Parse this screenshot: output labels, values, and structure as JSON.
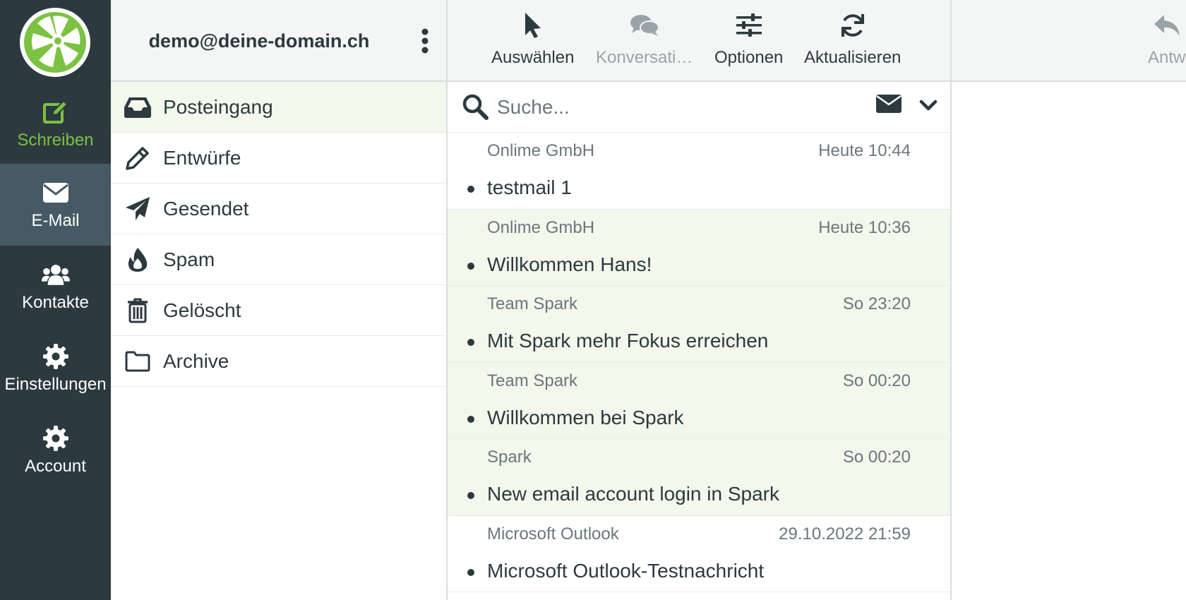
{
  "nav": {
    "items": [
      {
        "label": "Schreiben",
        "icon": "compose-icon"
      },
      {
        "label": "E-Mail",
        "icon": "envelope-icon"
      },
      {
        "label": "Kontakte",
        "icon": "users-icon"
      },
      {
        "label": "Einstellungen",
        "icon": "gear-icon"
      },
      {
        "label": "Account",
        "icon": "gear-icon"
      }
    ],
    "active": "E-Mail"
  },
  "account": {
    "email": "demo@deine-domain.ch"
  },
  "folders": [
    {
      "label": "Posteingang",
      "icon": "inbox-icon",
      "active": true
    },
    {
      "label": "Entwürfe",
      "icon": "pencil-icon"
    },
    {
      "label": "Gesendet",
      "icon": "paper-plane-icon"
    },
    {
      "label": "Spam",
      "icon": "fire-icon"
    },
    {
      "label": "Gelöscht",
      "icon": "trash-icon"
    },
    {
      "label": "Archive",
      "icon": "folder-icon"
    }
  ],
  "toolbar": {
    "select": "Auswählen",
    "conversations": "Konversati…",
    "options": "Optionen",
    "refresh": "Aktualisieren",
    "reply": "Antw"
  },
  "search": {
    "placeholder": "Suche..."
  },
  "messages": [
    {
      "sender": "Onlime GmbH",
      "date": "Heute 10:44",
      "subject": "testmail 1",
      "unread": false
    },
    {
      "sender": "Onlime GmbH",
      "date": "Heute 10:36",
      "subject": "Willkommen Hans!",
      "unread": true
    },
    {
      "sender": "Team Spark",
      "date": "So 23:20",
      "subject": "Mit Spark mehr Fokus erreichen",
      "unread": true
    },
    {
      "sender": "Team Spark",
      "date": "So 00:20",
      "subject": "Willkommen bei Spark",
      "unread": true
    },
    {
      "sender": "Spark",
      "date": "So 00:20",
      "subject": "New email account login in Spark",
      "unread": true
    },
    {
      "sender": "Microsoft Outlook",
      "date": "29.10.2022 21:59",
      "subject": "Microsoft Outlook-Testnachricht",
      "unread": false
    }
  ],
  "colors": {
    "nav_bg": "#2c3a3f",
    "nav_active": "#455a64",
    "accent_green": "#7cc242",
    "unread_bg": "#f3f7ec",
    "text": "#2c3a3f",
    "muted": "#6b777c"
  }
}
